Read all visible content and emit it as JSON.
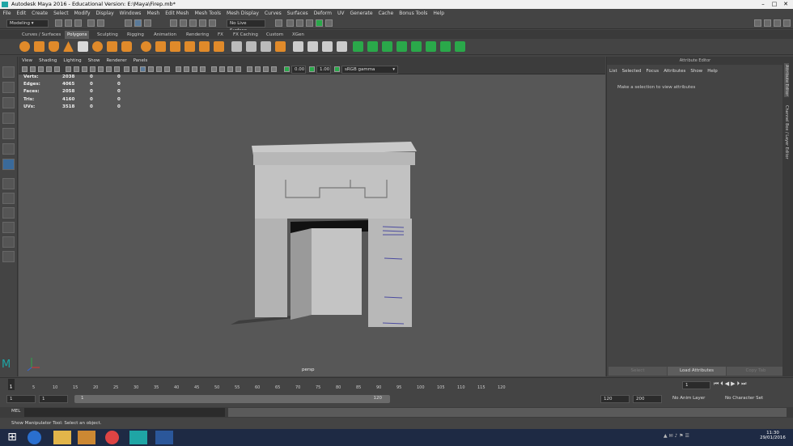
{
  "title_bar": {
    "title": "Autodesk Maya 2016 - Educational Version: E:\\Maya\\Firep.mb*"
  },
  "menu": [
    "File",
    "Edit",
    "Create",
    "Select",
    "Modify",
    "Display",
    "Windows",
    "Mesh",
    "Edit Mesh",
    "Mesh Tools",
    "Mesh Display",
    "Curves",
    "Surfaces",
    "Deform",
    "UV",
    "Generate",
    "Cache",
    "Bonus Tools",
    "Help"
  ],
  "status_line": {
    "mode": "Modeling",
    "live_surface": "No Live Surface"
  },
  "shelf_tabs": [
    "Curves / Surfaces",
    "Polygons",
    "Sculpting",
    "Rigging",
    "Animation",
    "Rendering",
    "FX",
    "FX Caching",
    "Custom",
    "XGen"
  ],
  "active_shelf_tab": "Polygons",
  "viewport": {
    "menu": [
      "View",
      "Shading",
      "Lighting",
      "Show",
      "Renderer",
      "Panels"
    ],
    "exposure": "0.00",
    "gamma": "1.00",
    "color_space": "sRGB gamma",
    "camera_label": "persp",
    "hud": [
      {
        "label": "Verts:",
        "values": [
          "2038",
          "0",
          "0"
        ]
      },
      {
        "label": "Edges:",
        "values": [
          "4065",
          "0",
          "0"
        ]
      },
      {
        "label": "Faces:",
        "values": [
          "2058",
          "0",
          "0"
        ]
      },
      {
        "label": "Tris:",
        "values": [
          "4160",
          "0",
          "0"
        ]
      },
      {
        "label": "UVs:",
        "values": [
          "3518",
          "0",
          "0"
        ]
      }
    ]
  },
  "attribute_editor": {
    "header": "Attribute Editor",
    "menu": [
      "List",
      "Selected",
      "Focus",
      "Attributes",
      "Show",
      "Help"
    ],
    "message": "Make a selection to view attributes",
    "buttons": [
      "Select",
      "Load Attributes",
      "Copy Tab"
    ]
  },
  "side_tabs": [
    "Attribute Editor",
    "Channel Box / Layer Editor"
  ],
  "time_slider": {
    "ticks": [
      "1",
      "5",
      "10",
      "15",
      "20",
      "25",
      "30",
      "35",
      "40",
      "45",
      "50",
      "55",
      "60",
      "65",
      "70",
      "75",
      "80",
      "85",
      "90",
      "95",
      "100",
      "105",
      "110",
      "115",
      "120"
    ],
    "current_frame": "1"
  },
  "range_slider": {
    "start": "1",
    "playback_start": "1",
    "range_label_start": "1",
    "range_label_end": "120",
    "playback_end": "120",
    "end": "200",
    "anim_layer": "No Anim Layer",
    "char_set": "No Character Set"
  },
  "command_line": {
    "label": "MEL"
  },
  "help_line": {
    "text": "Show Manipulator Tool: Select an object."
  },
  "taskbar": {
    "time": "11:30",
    "date": "29/01/2016"
  },
  "colors": {
    "accent_orange": "#e08a2a",
    "accent_green": "#2aa84a",
    "maya_teal": "#1fa5a5"
  }
}
